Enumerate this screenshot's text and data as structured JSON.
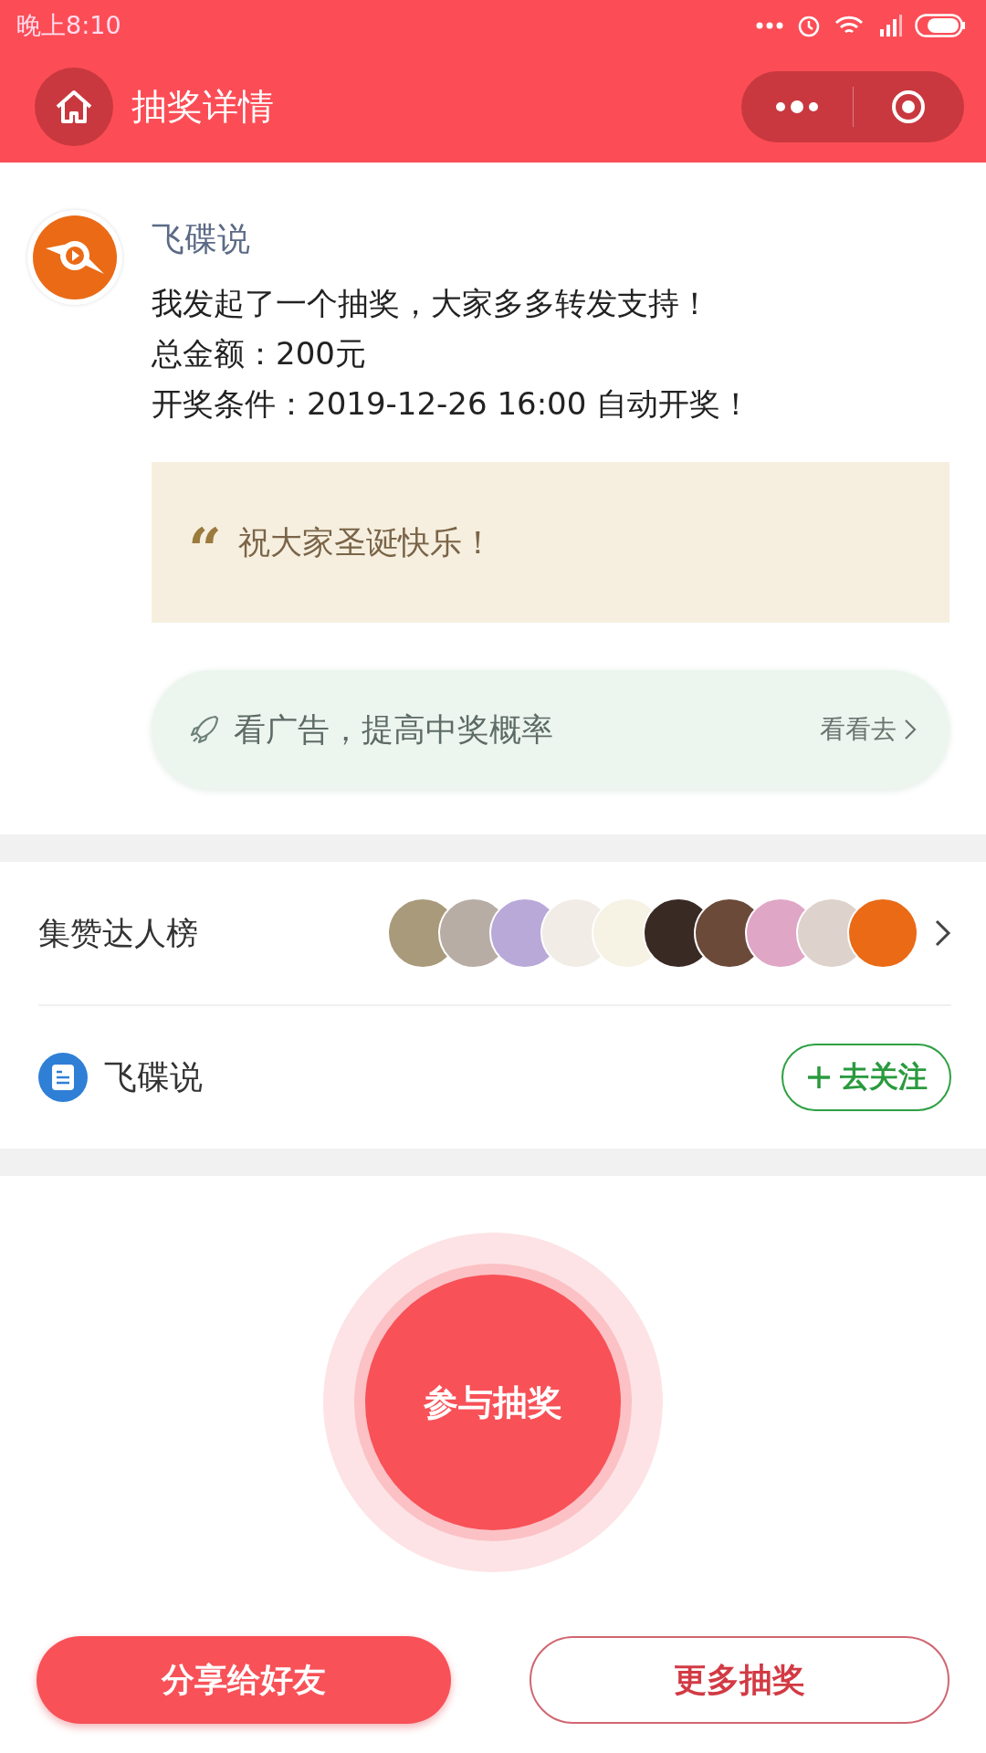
{
  "status_bar": {
    "time": "晚上8:10"
  },
  "nav": {
    "title": "抽奖详情"
  },
  "post": {
    "author": "飞碟说",
    "lines": [
      "我发起了一个抽奖，大家多多转发支持！",
      "总金额：200元",
      "开奖条件：2019-12-26 16:00 自动开奖！"
    ],
    "quote_mark": "“",
    "quote": "祝大家圣诞快乐！",
    "ad": {
      "text": "看广告，提高中奖概率",
      "action": "看看去"
    }
  },
  "leaderboard": {
    "title": "集赞达人榜"
  },
  "account": {
    "name": "飞碟说",
    "follow_button": "去关注"
  },
  "draw_button": "参与抽奖",
  "buttons": [
    {
      "label": "分享给好友",
      "kind": "primary"
    },
    {
      "label": "更多抽奖",
      "kind": "outline"
    }
  ]
}
